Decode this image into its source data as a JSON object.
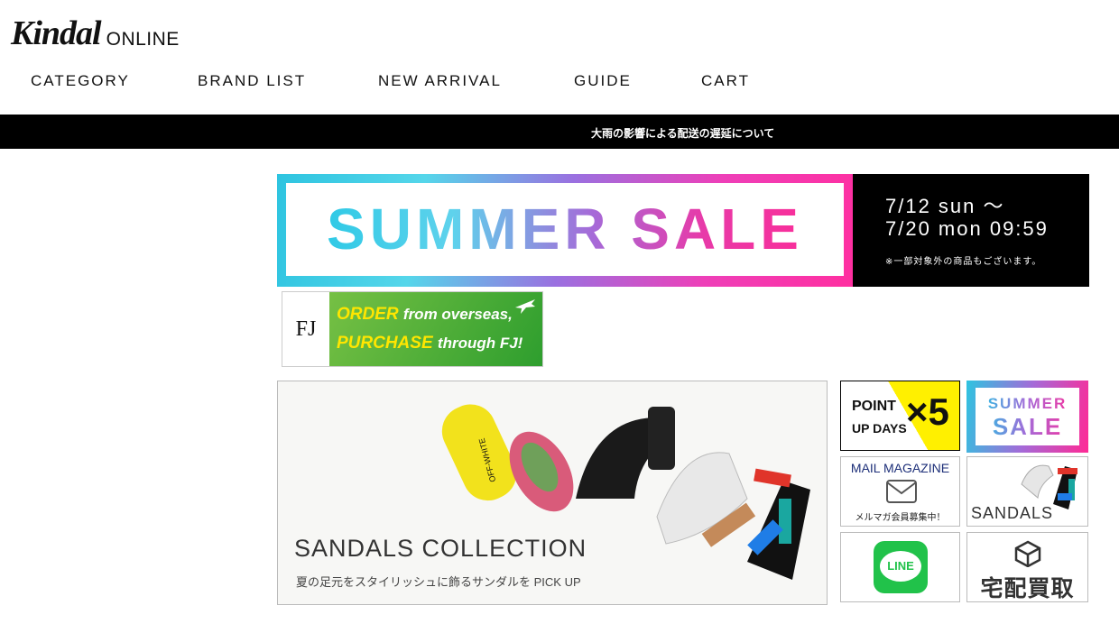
{
  "header": {
    "logo_script": "Kindal",
    "logo_online": "ONLINE"
  },
  "nav": [
    {
      "label": "CATEGORY"
    },
    {
      "label": "BRAND LIST"
    },
    {
      "label": "NEW ARRIVAL"
    },
    {
      "label": "GUIDE"
    },
    {
      "label": "CART"
    }
  ],
  "notice": {
    "text": "大雨の影響による配送の遅延について"
  },
  "sale_banner": {
    "title": "SUMMER SALE",
    "date_start": "7/12 sun 〜",
    "date_end": "7/20 mon 09:59",
    "note": "※一部対象外の商品もございます。"
  },
  "fj_banner": {
    "logo": "FJ",
    "line1_a": "ORDER",
    "line1_b": "from overseas,",
    "line2_a": "PURCHASE",
    "line2_b": "through FJ!"
  },
  "sandals_banner": {
    "title": "SANDALS  COLLECTION",
    "subtitle": "夏の足元をスタイリッシュに飾るサンダルを PICK UP"
  },
  "tiles": {
    "point": {
      "line1": "POINT",
      "line2": "UP DAYS",
      "mult": "×5"
    },
    "summer": {
      "line1": "SUMMER",
      "line2": "SALE"
    },
    "mail": {
      "title": "MAIL MAGAZINE",
      "sub": "メルマガ会員募集中！"
    },
    "sandals": {
      "label": "SANDALS"
    },
    "line": {
      "label": "LINE"
    },
    "kaitori": {
      "label": "宅配買取"
    }
  },
  "colors": {
    "cyan": "#2ec4e0",
    "magenta": "#ff2a95",
    "line_green": "#21c24a",
    "point_yellow": "#fff000"
  }
}
